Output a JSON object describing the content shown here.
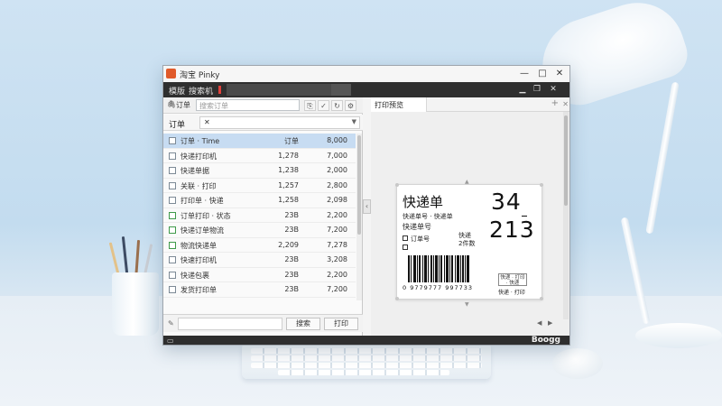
{
  "window": {
    "title": "淘宝 Pinky",
    "controls": {
      "minimize": "—",
      "maximize": "□",
      "close": "✕"
    }
  },
  "menubar": {
    "items": [
      "模版",
      "搜索机"
    ],
    "right_icons": [
      "minimize-icon",
      "restore-icon",
      "close-icon"
    ]
  },
  "left_panel": {
    "tab_label": "订单",
    "search_placeholder": "搜索订单",
    "toolbar_icons": [
      "copy-icon",
      "check-icon",
      "refresh-icon",
      "settings-icon"
    ],
    "filter_label": "订单",
    "filter_value": "✕",
    "rows": [
      {
        "name": "订单 · Time",
        "size": "订单",
        "num": "8,000",
        "selected": true,
        "checked": false
      },
      {
        "name": "快递打印机",
        "size": "1,278",
        "num": "7,000",
        "selected": false,
        "checked": false
      },
      {
        "name": "快递单据",
        "size": "1,238",
        "num": "2,000",
        "selected": false,
        "checked": false
      },
      {
        "name": "关联 · 打印",
        "size": "1,257",
        "num": "2,800",
        "selected": false,
        "checked": false
      },
      {
        "name": "打印单 · 快递",
        "size": "1,258",
        "num": "2,098",
        "selected": false,
        "checked": false
      },
      {
        "name": "订单打印 · 状态",
        "size": "23B",
        "num": "2,200",
        "selected": false,
        "checked": true
      },
      {
        "name": "快递订单物流",
        "size": "23B",
        "num": "7,200",
        "selected": false,
        "checked": true
      },
      {
        "name": "物流快递单",
        "size": "2,209",
        "num": "7,278",
        "selected": false,
        "checked": true
      },
      {
        "name": "快速打印机",
        "size": "23B",
        "num": "3,208",
        "selected": false,
        "checked": false
      },
      {
        "name": "快递包裹",
        "size": "23B",
        "num": "2,200",
        "selected": false,
        "checked": false
      },
      {
        "name": "发货打印单",
        "size": "23B",
        "num": "7,200",
        "selected": false,
        "checked": false
      }
    ],
    "bottom": {
      "search_btn": "搜索",
      "print_btn": "打印"
    }
  },
  "right_panel": {
    "tab_label": "打印预览",
    "add_icon": "+",
    "close_icon": "✕",
    "label": {
      "title": "快递单",
      "big_number_top": "34",
      "big_number_bottom": "213",
      "sub_line1": "快递单号 · 快递单",
      "sub_line2": "快递单号",
      "field_a": "订单号",
      "field_b": "快递",
      "field_c": "2件数",
      "barcode_number": "0 9779777 997733",
      "stamp_text": "快递 · 打印 · 快递",
      "stamp_sub": "快递 · 打印"
    },
    "nav_prev": "◀",
    "nav_next": "▶"
  },
  "statusbar": {
    "brand": "Boogg"
  }
}
